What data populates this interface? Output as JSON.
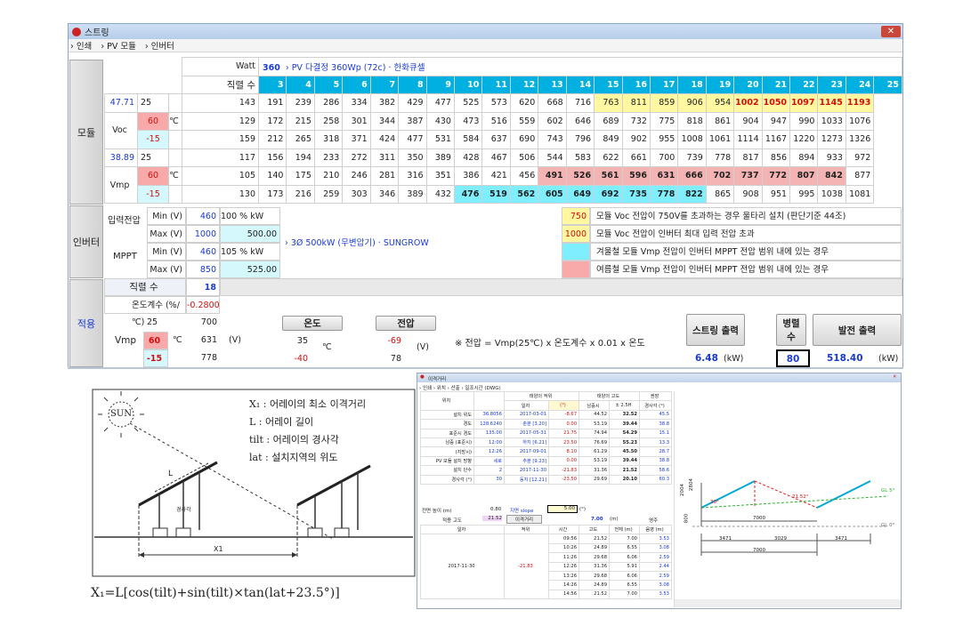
{
  "main_window": {
    "title": "스트링",
    "menu": [
      "› 인쇄",
      "› PV 모듈",
      "› 인버터"
    ],
    "sections": {
      "module": "모듈",
      "inverter": "인버터",
      "apply": "적용"
    },
    "header": {
      "watt_label": "Watt",
      "watt_value": "360",
      "module_name": "› PV 다결정 360Wp (72c) · 한화큐셀",
      "series_label": "직렬 수"
    },
    "series": [
      "3",
      "4",
      "5",
      "6",
      "7",
      "8",
      "9",
      "10",
      "11",
      "12",
      "13",
      "14",
      "15",
      "16",
      "17",
      "18",
      "19",
      "20",
      "21",
      "22",
      "23",
      "24",
      "25"
    ],
    "voc_label": "Voc",
    "vmp_label": "Vmp",
    "unit_c": "℃",
    "voc_base": "47.71",
    "vmp_base": "38.89",
    "temps": [
      "25",
      "60",
      "-15"
    ],
    "voc_rows": [
      [
        "143",
        "191",
        "239",
        "286",
        "334",
        "382",
        "429",
        "477",
        "525",
        "573",
        "620",
        "668",
        "716",
        "763",
        "811",
        "859",
        "906",
        "954",
        "1002",
        "1050",
        "1097",
        "1145",
        "1193"
      ],
      [
        "129",
        "172",
        "215",
        "258",
        "301",
        "344",
        "387",
        "430",
        "473",
        "516",
        "559",
        "602",
        "646",
        "689",
        "732",
        "775",
        "818",
        "861",
        "904",
        "947",
        "990",
        "1033",
        "1076"
      ],
      [
        "159",
        "212",
        "265",
        "318",
        "371",
        "424",
        "477",
        "531",
        "584",
        "637",
        "690",
        "743",
        "796",
        "849",
        "902",
        "955",
        "1008",
        "1061",
        "1114",
        "1167",
        "1220",
        "1273",
        "1326"
      ]
    ],
    "vmp_rows": [
      [
        "117",
        "156",
        "194",
        "233",
        "272",
        "311",
        "350",
        "389",
        "428",
        "467",
        "506",
        "544",
        "583",
        "622",
        "661",
        "700",
        "739",
        "778",
        "817",
        "856",
        "894",
        "933",
        "972"
      ],
      [
        "105",
        "140",
        "175",
        "210",
        "246",
        "281",
        "316",
        "351",
        "386",
        "421",
        "456",
        "491",
        "526",
        "561",
        "596",
        "631",
        "666",
        "702",
        "737",
        "772",
        "807",
        "842",
        "877"
      ],
      [
        "130",
        "173",
        "216",
        "259",
        "303",
        "346",
        "389",
        "432",
        "476",
        "519",
        "562",
        "605",
        "649",
        "692",
        "735",
        "778",
        "822",
        "865",
        "908",
        "951",
        "995",
        "1038",
        "1081"
      ]
    ],
    "inverter": {
      "input_label": "입력전압",
      "mppt_label": "MPPT",
      "rows": [
        {
          "label": "Min (V)",
          "value": "460",
          "pct": "100 % kW",
          "kw": ""
        },
        {
          "label": "Max (V)",
          "value": "1000",
          "pct": "",
          "kw": "500.00"
        },
        {
          "label": "Min (V)",
          "value": "460",
          "pct": "105 % kW",
          "kw": ""
        },
        {
          "label": "Max (V)",
          "value": "850",
          "pct": "",
          "kw": "525.00"
        }
      ],
      "name": "› 3Ø 500kW (무변압기) · SUNGROW",
      "legend": [
        {
          "key": "750",
          "text": "모듈 Voc 전압이 750V를 초과하는 경우 울타리 설치 (판단기준 44조)"
        },
        {
          "key": "1000",
          "text": "모듈 Voc 전압이 인버터 최대 입력 전압 초과"
        },
        {
          "key": "",
          "text": "겨울철 모듈 Vmp 전압이 인버터 MPPT 전압 범위 내에 있는 경우"
        },
        {
          "key": "",
          "text": "여름철 모듈 Vmp 전압이 인버터 MPPT 전압 범위 내에 있는 경우"
        }
      ]
    },
    "apply": {
      "series_label": "직렬 수",
      "series_value": "18",
      "coef_label": "온도계수 (%/℃)",
      "coef_value": "-0.2800",
      "vmp_label": "Vmp",
      "temps": [
        "25",
        "60",
        "-15"
      ],
      "unit_c": "℃",
      "vmp_values": [
        "700",
        "631",
        "778"
      ],
      "unit_v": "(V)",
      "temp_btn": "온도",
      "temp_values": [
        "35",
        "-40"
      ],
      "volt_btn": "전압",
      "volt_values": [
        "-69",
        "78"
      ],
      "formula": "※ 전압 = Vmp(25℃) x 온도계수 x 0.01 x 온도",
      "string_btn": "스트링 출력",
      "string_value": "6.48",
      "unit_kw": "(kW)",
      "parallel_btn": "병렬 수",
      "parallel_value": "80",
      "gen_btn": "발전 출력",
      "gen_value": "518.40"
    }
  },
  "diagram": {
    "sun": "SUN",
    "legend": [
      "X₁ : 어레이의 최소 이격거리",
      "L : 어레이 길이",
      "tilt : 어레이의 경사각",
      "lat : 설치지역의 위도"
    ],
    "labels": {
      "L": "L",
      "angle": "경사각",
      "x1": "X1"
    },
    "formula": "X₁=L[cos(tilt)+sin(tilt)×tan(lat+23.5°)]"
  },
  "spacing_window": {
    "title": "이격거리",
    "menu": "› 인쇄  › 위치  › 산출  › 일조시간  (DWG)",
    "headers": {
      "location": "위치",
      "sun_lat": "태양의 적위",
      "sun_alt": "태양의 고도",
      "recommend": "권장",
      "date": "일자",
      "deg": "(°)",
      "south": "남중시",
      "pm": "± 2.5H",
      "tilt": "경사각 (°)"
    },
    "rows": [
      [
        "설치 위도",
        "36.8056",
        "2017-03-01",
        "-8.67",
        "44.52",
        "32.52",
        "45.5"
      ],
      [
        "경도",
        "128.6240",
        "춘분 [3.20]",
        "0.00",
        "53.19",
        "39.44",
        "38.8"
      ],
      [
        "표준시 경도",
        "135.00",
        "2017-05-31",
        "21.75",
        "74.94",
        "54.29",
        "15.1"
      ],
      [
        "남중 (표준시)",
        "12:00",
        "하지 [6.21]",
        "23.50",
        "76.69",
        "55.23",
        "13.3"
      ],
      [
        "(지방시)",
        "12:26",
        "2017-09-01",
        "8.10",
        "61.29",
        "45.50",
        "28.7"
      ],
      [
        "PV 모듈 설치 방향",
        "세로",
        "추분 [9.23]",
        "0.00",
        "53.19",
        "39.44",
        "38.8"
      ],
      [
        "설치 단수",
        "2",
        "2017-11-30",
        "-21.83",
        "31.36",
        "21.52",
        "58.6"
      ],
      [
        "경사각 (°)",
        "30",
        "동지 [12.21]",
        "-23.50",
        "29.69",
        "20.10",
        "60.3"
      ]
    ],
    "front_label": "전면 높이 (m)",
    "front_value": "0.80",
    "slope": "지면 slope",
    "slope_value": "5.00",
    "slope_unit": "(°)",
    "apply_label": "적용 고도",
    "apply_value": "21.52",
    "apply_btn": "이격거리",
    "apply_dist": "7.00",
    "apply_m": "(m)",
    "shadow": "영주",
    "sub_headers": [
      "일자",
      "적위",
      "시간",
      "고도",
      "전체 (m)",
      "음영 (m)"
    ],
    "date": "2017-11-30",
    "decl": "-21.83",
    "sub_rows": [
      [
        "09:56",
        "21.52",
        "7.00",
        "3.53"
      ],
      [
        "10:26",
        "24.89",
        "6.55",
        "3.08"
      ],
      [
        "11:26",
        "29.68",
        "6.06",
        "2.59"
      ],
      [
        "12:26",
        "31.36",
        "5.91",
        "2.44"
      ],
      [
        "13:26",
        "29.68",
        "6.06",
        "2.59"
      ],
      [
        "14:26",
        "24.89",
        "6.55",
        "3.08"
      ],
      [
        "14:56",
        "21.52",
        "7.00",
        "3.53"
      ]
    ],
    "cad": {
      "h1": "2004",
      "h2": "2804",
      "h3": "800",
      "a1": "30°",
      "a2": "21.52°",
      "d1": "7000",
      "gl1": "GL 5°",
      "gl0": "GL 0°",
      "b1": "3471",
      "b2": "3029",
      "b3": "3471",
      "b4": "7000"
    }
  }
}
